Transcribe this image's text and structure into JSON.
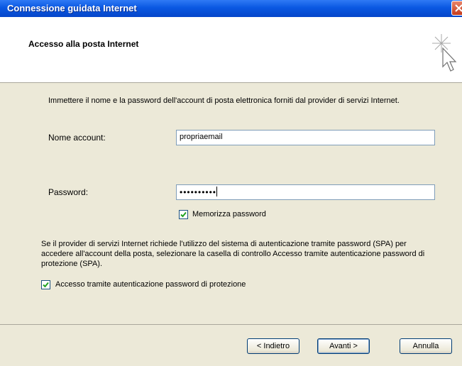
{
  "window": {
    "title": "Connessione guidata Internet"
  },
  "header": {
    "heading": "Accesso alla posta Internet",
    "icon": "wizard-sparkle-cursor-icon"
  },
  "intro": "Immettere il nome e la password dell'account di posta elettronica forniti dal provider di servizi Internet.",
  "account": {
    "label": "Nome account:",
    "value": "propriaemail"
  },
  "password": {
    "label": "Password:",
    "masked_value": "••••••••••"
  },
  "remember": {
    "label": "Memorizza password",
    "checked": true
  },
  "spa": {
    "text": "Se il provider di servizi Internet richiede l'utilizzo del sistema di autenticazione tramite password (SPA) per accedere all'account della posta, selezionare la casella di controllo Accesso tramite autenticazione password di protezione (SPA).",
    "checkbox_label": "Accesso tramite autenticazione password di protezione",
    "checked": true
  },
  "buttons": {
    "back": "< Indietro",
    "next": "Avanti >",
    "cancel": "Annulla"
  },
  "colors": {
    "titlebar": "#0a58e2",
    "dialog_bg": "#ece9d8",
    "check_mark": "#21a121"
  }
}
